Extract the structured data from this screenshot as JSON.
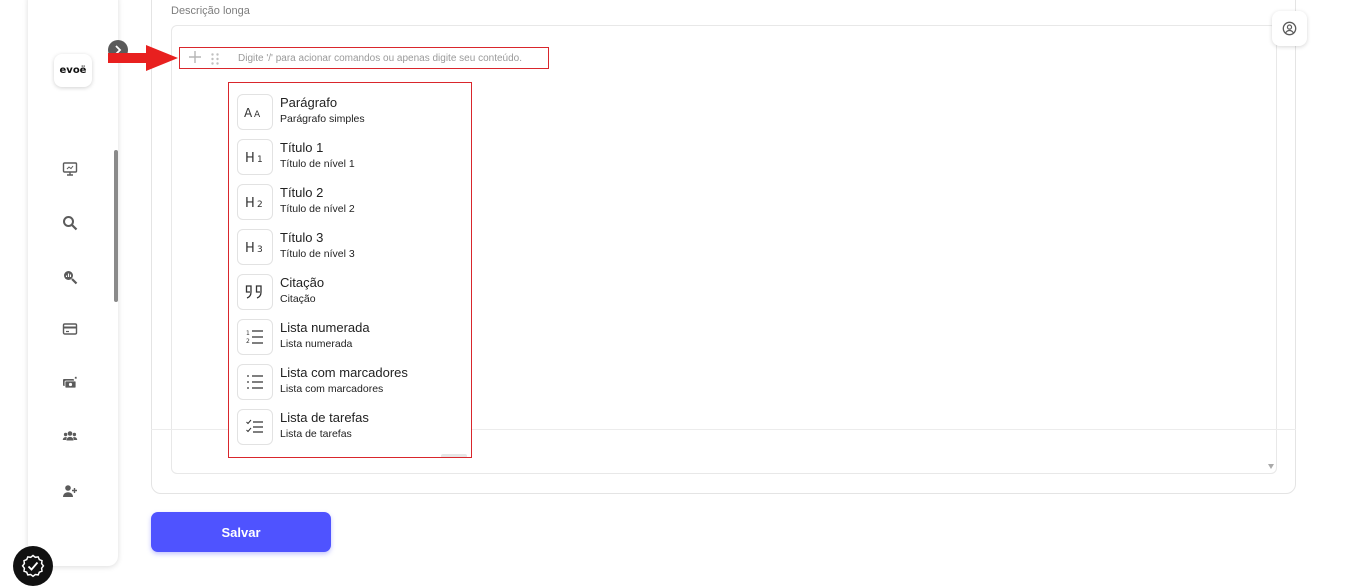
{
  "app": {
    "logo_text": "evoë"
  },
  "sidebar": {
    "items": [
      {
        "icon": "monitor-icon"
      },
      {
        "icon": "search-icon"
      },
      {
        "icon": "search-analytics-icon"
      },
      {
        "icon": "credit-card-icon"
      },
      {
        "icon": "money-icon"
      },
      {
        "icon": "group-icon"
      },
      {
        "icon": "add-user-icon"
      }
    ]
  },
  "form": {
    "field_label": "Descrição longa",
    "editor_placeholder": "Digite '/' para acionar comandos ou apenas digite seu conteúdo.",
    "save_label": "Salvar"
  },
  "slash_menu": {
    "items": [
      {
        "glyph": "Aa",
        "title": "Parágrafo",
        "subtitle": "Parágrafo simples",
        "icon": "paragraph-icon"
      },
      {
        "glyph": "H1",
        "title": "Título 1",
        "subtitle": "Título de nível 1",
        "icon": "heading-1-icon"
      },
      {
        "glyph": "H2",
        "title": "Título 2",
        "subtitle": "Título de nível 2",
        "icon": "heading-2-icon"
      },
      {
        "glyph": "H3",
        "title": "Título 3",
        "subtitle": "Título de nível 3",
        "icon": "heading-3-icon"
      },
      {
        "glyph": "99",
        "title": "Citação",
        "subtitle": "Citação",
        "icon": "quote-icon"
      },
      {
        "glyph": "ol",
        "title": "Lista numerada",
        "subtitle": "Lista numerada",
        "icon": "numbered-list-icon"
      },
      {
        "glyph": "ul",
        "title": "Lista com marcadores",
        "subtitle": "Lista com marcadores",
        "icon": "bulleted-list-icon"
      },
      {
        "glyph": "todo",
        "title": "Lista de tarefas",
        "subtitle": "Lista de tarefas",
        "icon": "task-list-icon"
      }
    ]
  },
  "colors": {
    "accent": "#4f53ff",
    "annotation": "#d9262c"
  }
}
